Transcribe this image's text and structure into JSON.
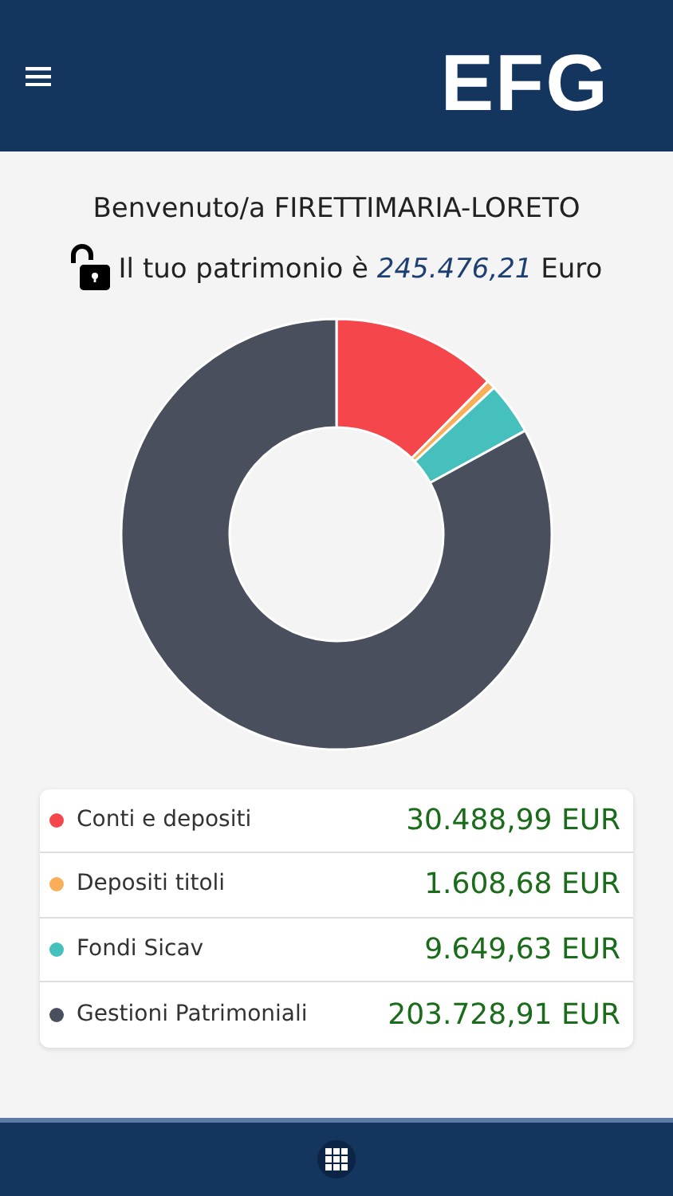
{
  "header": {
    "logo": "EFG"
  },
  "welcome": {
    "greeting": "Benvenuto/a",
    "name": "FIRETTIMARIA-LORETO"
  },
  "patrimonio": {
    "locked": false,
    "label": "Il tuo patrimonio è",
    "amount": "245.476,21",
    "currency": "Euro"
  },
  "chart_data": {
    "type": "donut",
    "series": [
      {
        "colors": [
          "#f5474b",
          "#f9ae5a",
          "#45c0bd",
          "#4a4f5d"
        ],
        "values": [
          12.42,
          0.66,
          3.93,
          82.99
        ]
      }
    ]
  },
  "assets": [
    {
      "label": "Conti e depositi",
      "value": "30.488,99 EUR",
      "color": "#f5474b"
    },
    {
      "label": "Depositi titoli",
      "value": "1.608,68 EUR",
      "color": "#f9ae5a"
    },
    {
      "label": "Fondi Sicav",
      "value": "9.649,63 EUR",
      "color": "#45c0bd"
    },
    {
      "label": "Gestioni Patrimoniali",
      "value": "203.728,91 EUR",
      "color": "#4a4f5d"
    }
  ]
}
